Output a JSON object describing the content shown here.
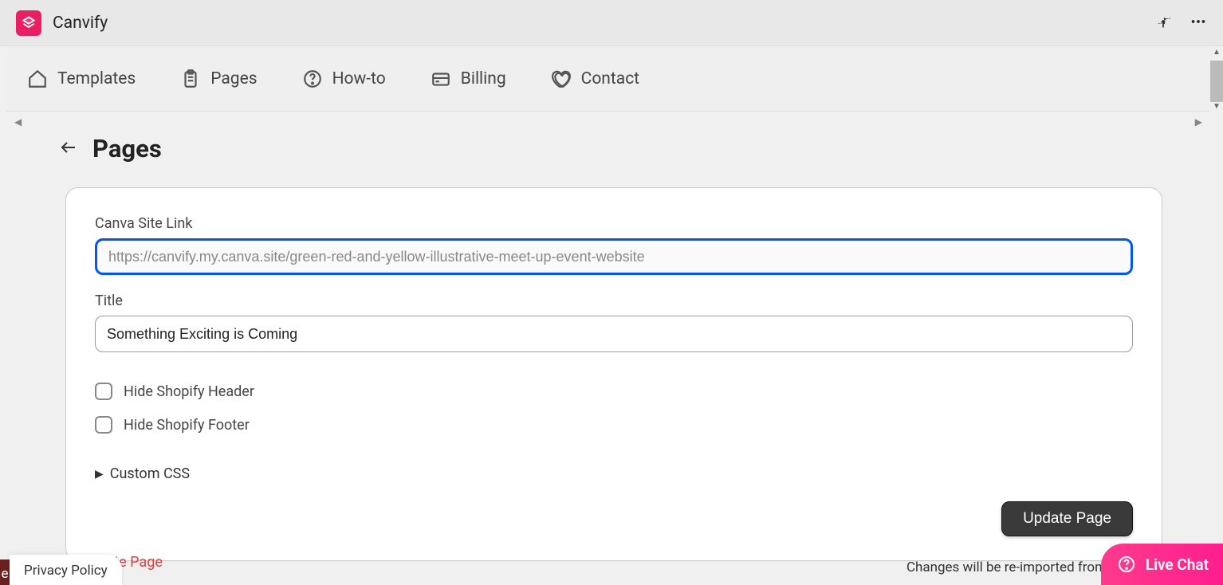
{
  "app": {
    "name": "Canvify"
  },
  "nav": {
    "items": [
      {
        "label": "Templates"
      },
      {
        "label": "Pages"
      },
      {
        "label": "How-to"
      },
      {
        "label": "Billing"
      },
      {
        "label": "Contact"
      }
    ]
  },
  "page": {
    "title": "Pages"
  },
  "form": {
    "canva_link_label": "Canva Site Link",
    "canva_link_placeholder": "https://canvify.my.canva.site/green-red-and-yellow-illustrative-meet-up-event-website",
    "title_label": "Title",
    "title_value": "Something Exciting is Coming",
    "hide_header_label": "Hide Shopify Header",
    "hide_footer_label": "Hide Shopify Footer",
    "custom_css_label": "Custom CSS",
    "update_button": "Update Page",
    "delete_link": "Delete Page",
    "reimport_note": "Changes will be re-imported from"
  },
  "footer": {
    "privacy": "Privacy Policy",
    "corner_char": "e"
  },
  "livechat": {
    "label": "Live Chat"
  }
}
